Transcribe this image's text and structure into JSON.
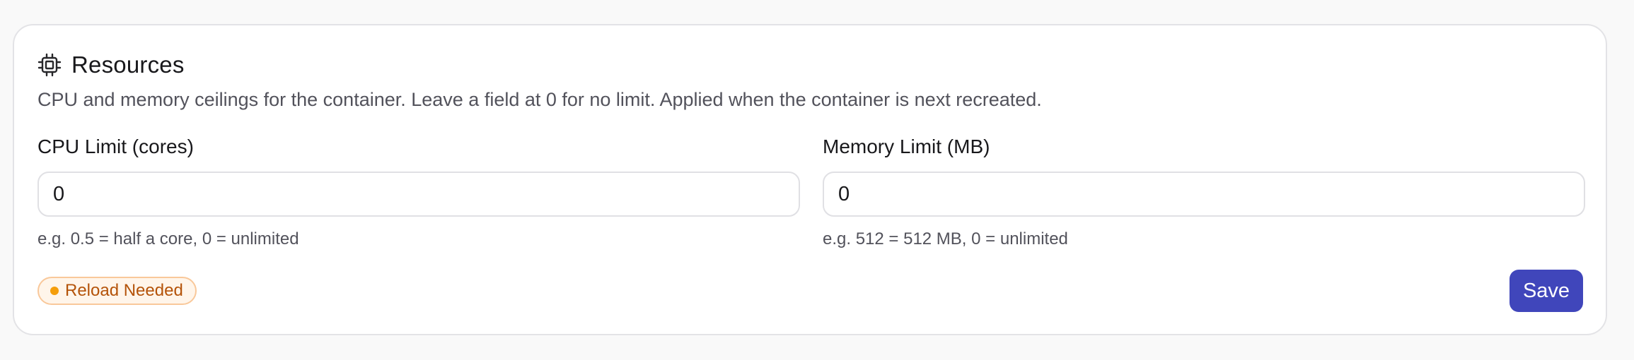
{
  "resources": {
    "title": "Resources",
    "icon": "cpu-chip-icon",
    "description": "CPU and memory ceilings for the container. Leave a field at 0 for no limit. Applied when the container is next recreated.",
    "cpu": {
      "label": "CPU Limit (cores)",
      "value": "0",
      "hint": "e.g. 0.5 = half a core, 0 = unlimited"
    },
    "memory": {
      "label": "Memory Limit (MB)",
      "value": "0",
      "hint": "e.g. 512 = 512 MB, 0 = unlimited"
    },
    "badge": {
      "label": "Reload Needed",
      "color": "#f59e0b"
    },
    "save_label": "Save",
    "accent": "#4046bb"
  }
}
